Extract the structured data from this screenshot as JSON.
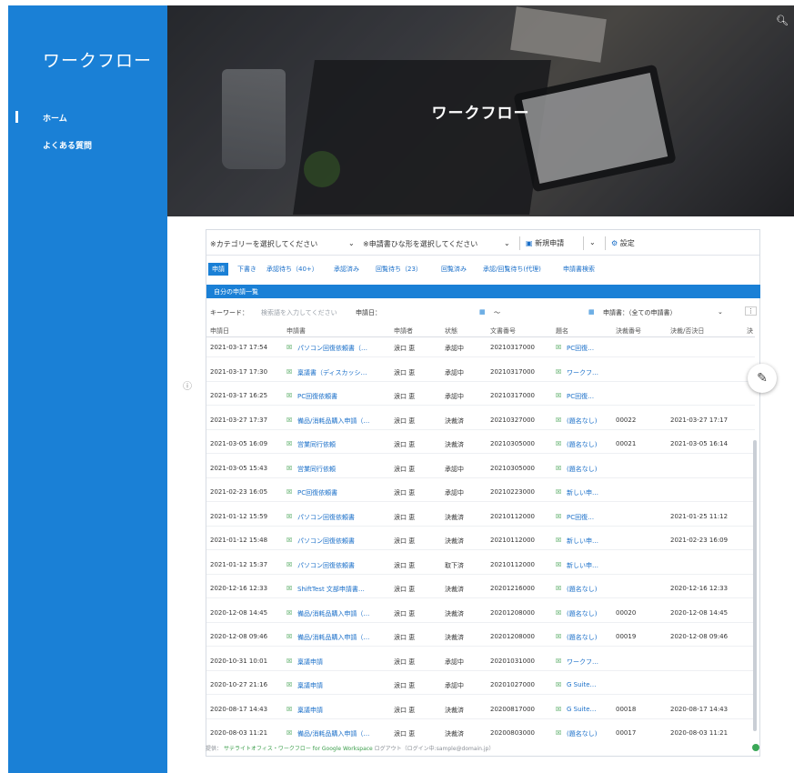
{
  "sidebar": {
    "brand": "ワークフロー",
    "items": [
      {
        "label": "ホーム"
      },
      {
        "label": "よくある質問"
      }
    ]
  },
  "hero": {
    "title": "ワークフロー"
  },
  "toolbar": {
    "category_select": "※カテゴリーを選択してください",
    "form_select": "※申請書ひな形を選択してください",
    "new_request": "新規申請",
    "settings": "設定"
  },
  "tabs": [
    "申請",
    "下書き",
    "承認待ち（40+）",
    "承認済み",
    "回覧待ち（23）",
    "回覧済み",
    "承認/回覧待ち(代理)",
    "申請書検索"
  ],
  "list_title": "自分の申請一覧",
  "filter": {
    "keyword_label": "キーワード：",
    "keyword_placeholder": "検索語を入力してください",
    "date_label": "申請日：",
    "range_sep": "〜",
    "form_label": "申請書：（全ての申請書）"
  },
  "columns": [
    "申請日",
    "申請書",
    "申請者",
    "状態",
    "文書番号",
    "題名",
    "",
    "決裁番号",
    "決裁/否決日",
    "決"
  ],
  "rows": [
    [
      "2021-03-17 17:54",
      "パソコン回復依頼書（…",
      "涙口 恵",
      "承認中",
      "20210317000",
      "PC回復…",
      "",
      "",
      ""
    ],
    [
      "2021-03-17 17:30",
      "稟議書（ディスカッシ…",
      "涙口 恵",
      "承認中",
      "20210317000",
      "ワークフ…",
      "",
      "",
      ""
    ],
    [
      "2021-03-17 16:25",
      "PC回復依頼書",
      "涙口 恵",
      "承認中",
      "20210317000",
      "PC回復…",
      "",
      "",
      ""
    ],
    [
      "2021-03-27 17:37",
      "備品/消耗品購入申請（…",
      "涙口 恵",
      "決裁済",
      "20210327000",
      "(題名なし)",
      "00022",
      "2021-03-27 17:17",
      ""
    ],
    [
      "2021-03-05 16:09",
      "営業同行依頼",
      "涙口 恵",
      "決裁済",
      "20210305000",
      "(題名なし)",
      "00021",
      "2021-03-05 16:14",
      ""
    ],
    [
      "2021-03-05 15:43",
      "営業同行依頼",
      "涙口 恵",
      "承認中",
      "20210305000",
      "(題名なし)",
      "",
      "",
      ""
    ],
    [
      "2021-02-23 16:05",
      "PC回復依頼書",
      "涙口 恵",
      "承認中",
      "20210223000",
      "新しい申…",
      "",
      "",
      ""
    ],
    [
      "2021-01-12 15:59",
      "パソコン回復依頼書",
      "涙口 恵",
      "決裁済",
      "20210112000",
      "PC回復…",
      "",
      "2021-01-25 11:12",
      ""
    ],
    [
      "2021-01-12 15:48",
      "パソコン回復依頼書",
      "涙口 恵",
      "決裁済",
      "20210112000",
      "新しい申…",
      "",
      "2021-02-23 16:09",
      ""
    ],
    [
      "2021-01-12 15:37",
      "パソコン回復依頼書",
      "涙口 恵",
      "取下済",
      "20210112000",
      "新しい申…",
      "",
      "",
      ""
    ],
    [
      "2020-12-16 12:33",
      "ShiftTest 文部申請書…",
      "涙口 恵",
      "決裁済",
      "20201216000",
      "(題名なし)",
      "",
      "2020-12-16 12:33",
      ""
    ],
    [
      "2020-12-08 14:45",
      "備品/消耗品購入申請（…",
      "涙口 恵",
      "決裁済",
      "20201208000",
      "(題名なし)",
      "00020",
      "2020-12-08 14:45",
      ""
    ],
    [
      "2020-12-08 09:46",
      "備品/消耗品購入申請（…",
      "涙口 恵",
      "決裁済",
      "20201208000",
      "(題名なし)",
      "00019",
      "2020-12-08 09:46",
      ""
    ],
    [
      "2020-10-31 10:01",
      "稟議申請",
      "涙口 恵",
      "承認中",
      "20201031000",
      "ワークフ…",
      "",
      "",
      ""
    ],
    [
      "2020-10-27 21:16",
      "稟議申請",
      "涙口 恵",
      "承認中",
      "20201027000",
      "G Suite…",
      "",
      "",
      ""
    ],
    [
      "2020-08-17 14:43",
      "稟議申請",
      "涙口 恵",
      "決裁済",
      "20200817000",
      "G Suite…",
      "00018",
      "2020-08-17 14:43",
      ""
    ],
    [
      "2020-08-03 11:21",
      "備品/消耗品購入申請（…",
      "涙口 恵",
      "決裁済",
      "20200803000",
      "(題名なし)",
      "00017",
      "2020-08-03 11:21",
      ""
    ]
  ],
  "footer": {
    "prefix": "提供：",
    "product": "サテライトオフィス・ワークフロー for Google Workspace",
    "account": "ログアウト（ログイン中:sample@domain.jp）"
  },
  "colors": {
    "accent": "#1a80d6",
    "link": "#1a6fc9",
    "green": "#3a9d4a"
  }
}
